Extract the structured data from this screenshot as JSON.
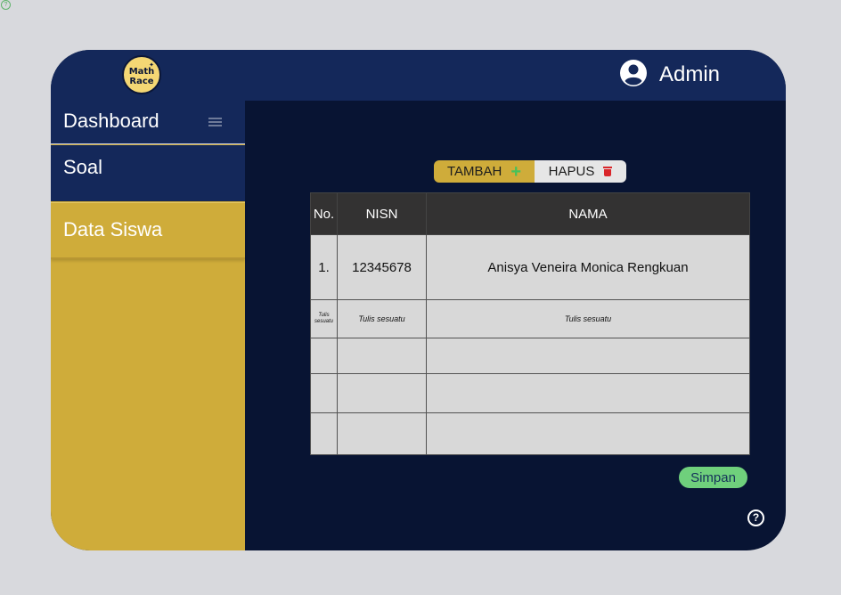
{
  "corner_help": "?",
  "logo": {
    "line1": "Math",
    "line2": "Race"
  },
  "header": {
    "user_label": "Admin"
  },
  "sidebar": {
    "items": [
      {
        "label": "Dashboard"
      },
      {
        "label": "Soal"
      },
      {
        "label": "Data Siswa"
      }
    ]
  },
  "actions": {
    "add_label": "TAMBAH",
    "delete_label": "HAPUS",
    "add_glyph": "+"
  },
  "table": {
    "columns": [
      "No.",
      "NISN",
      "NAMA"
    ],
    "rows": [
      [
        "1.",
        "12345678",
        "Anisya Veneira Monica Rengkuan"
      ],
      [
        "Tulis sesuatu",
        "Tulis sesuatu",
        "Tulis sesuatu"
      ],
      [
        "",
        "",
        ""
      ],
      [
        "",
        "",
        ""
      ],
      [
        "",
        "",
        ""
      ]
    ]
  },
  "save_label": "Simpan",
  "help_glyph": "?",
  "colors": {
    "page_bg": "#d8d9dd",
    "header": "#14285a",
    "main_bg": "#081433",
    "accent_gold": "#cfac3a",
    "save_green": "#6fd07c",
    "table_header": "#333232",
    "table_cell": "#d8d8d8"
  }
}
